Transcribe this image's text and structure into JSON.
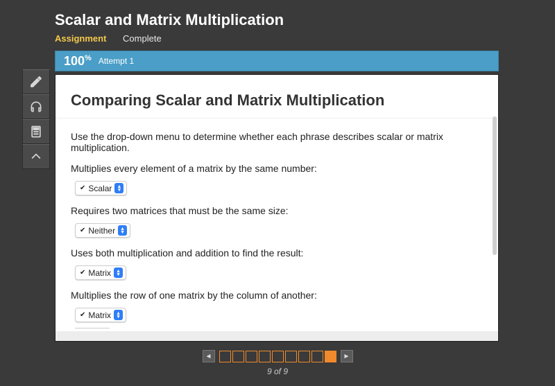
{
  "header": {
    "title": "Scalar and Matrix Multiplication",
    "assignment_label": "Assignment",
    "status": "Complete"
  },
  "score": {
    "percent": "100",
    "percent_sym": "%",
    "attempt": "Attempt 1"
  },
  "question": {
    "heading": "Comparing Scalar and Matrix Multiplication",
    "instruction": "Use the drop-down menu to determine whether each phrase describes scalar or matrix multiplication.",
    "items": [
      {
        "prompt": "Multiplies every element of a matrix by the same number:",
        "value": "Scalar"
      },
      {
        "prompt": "Requires two matrices that must be the same size:",
        "value": "Neither"
      },
      {
        "prompt": "Uses both multiplication and addition to find the result:",
        "value": "Matrix"
      },
      {
        "prompt": "Multiplies the row of one matrix by the column of another:",
        "value": "Matrix"
      }
    ]
  },
  "toolbar": {
    "icons": [
      "pencil-icon",
      "headphones-icon",
      "calculator-icon",
      "collapse-up-icon"
    ]
  },
  "pager": {
    "current": 9,
    "total": 9,
    "label": "9 of 9"
  }
}
